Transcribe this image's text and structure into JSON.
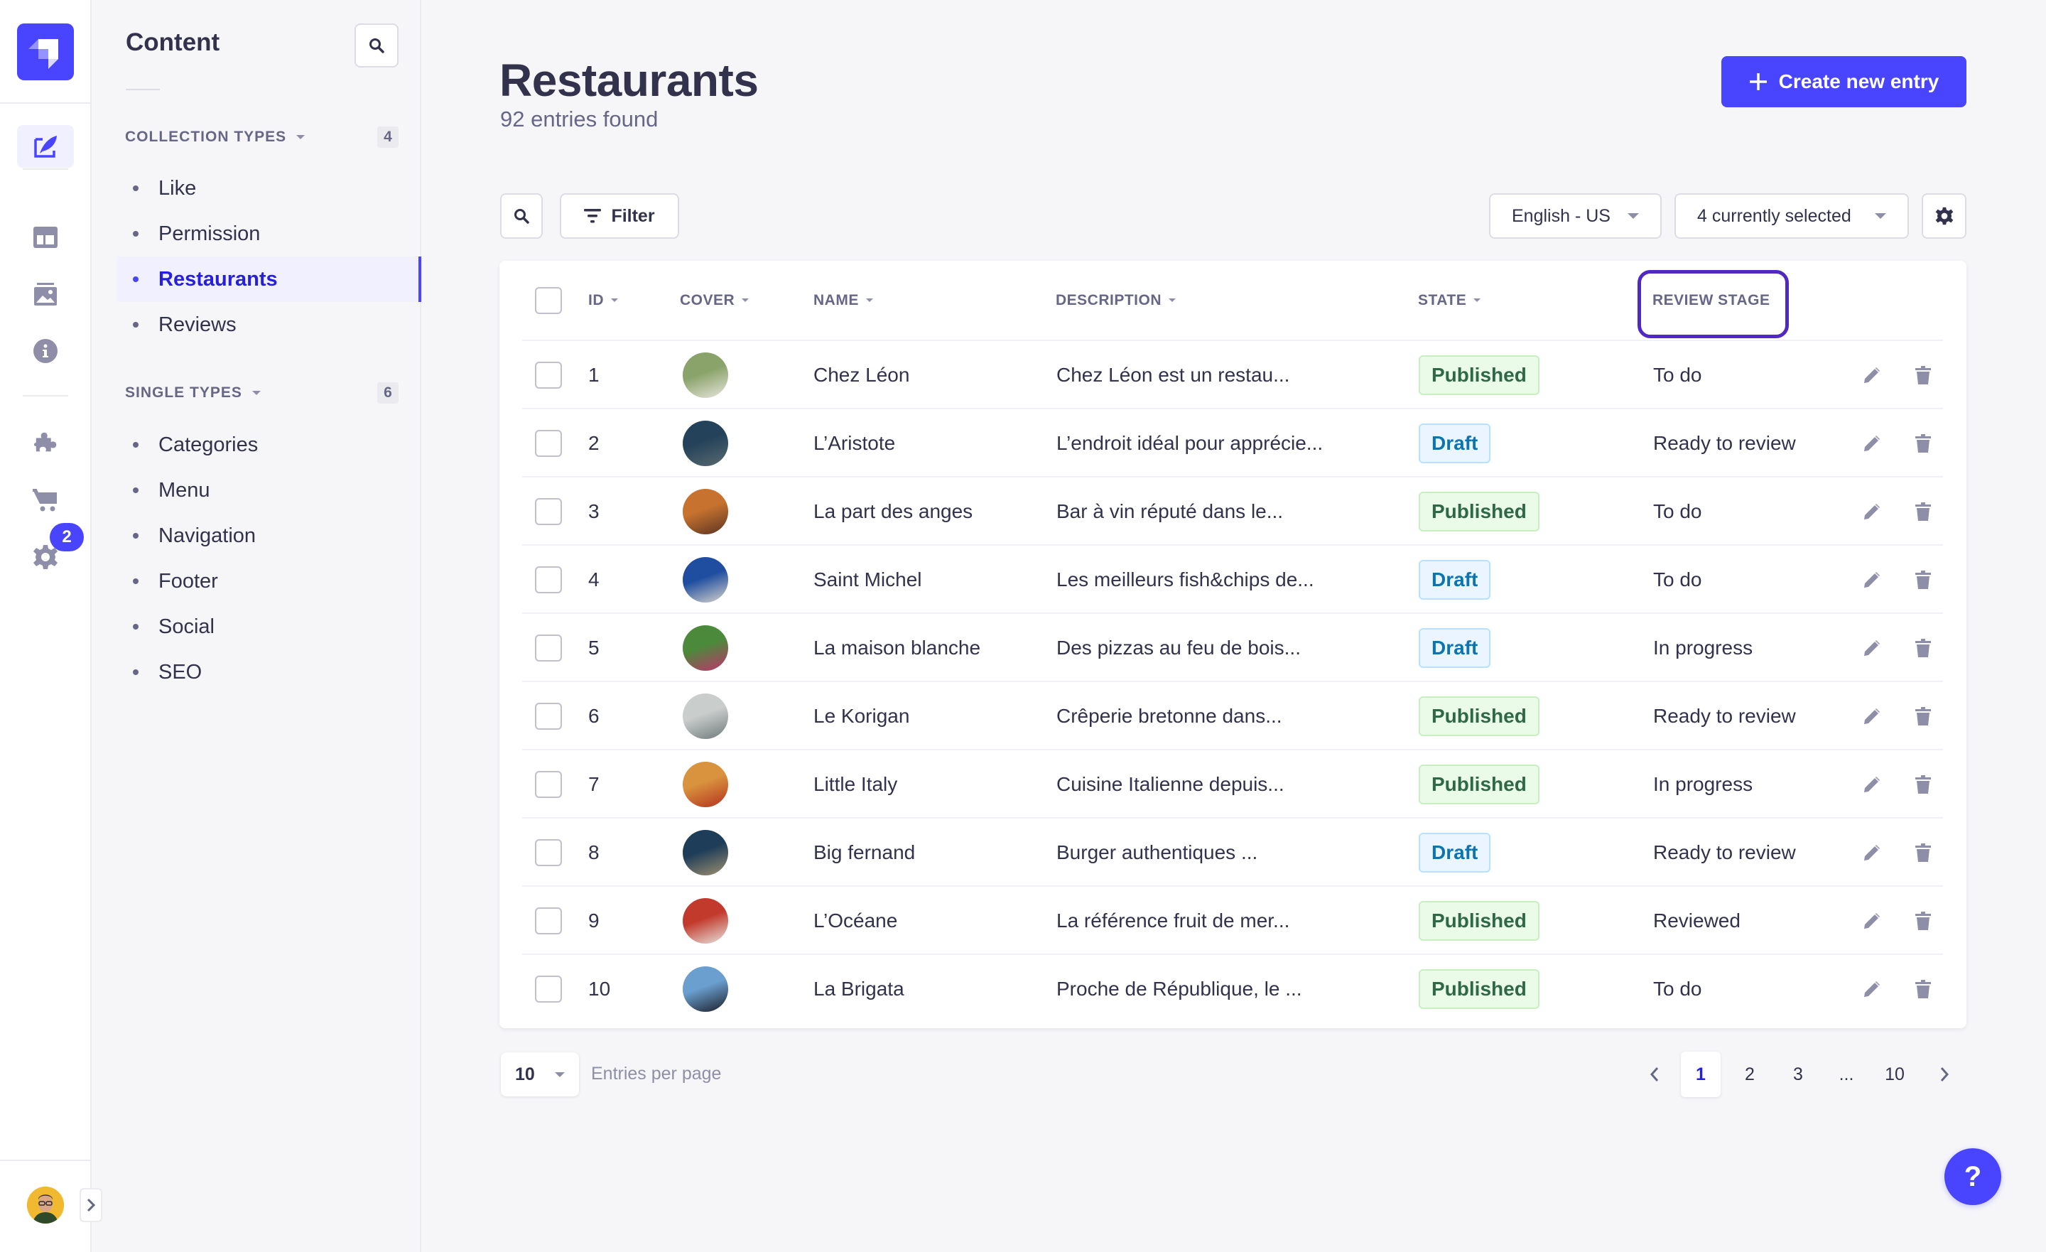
{
  "colors": {
    "primary": "#4945ff",
    "text": "#32324d",
    "muted": "#666687",
    "published_bg": "#eafbe7",
    "published_text": "#2f6846",
    "draft_bg": "#eaf5ff",
    "draft_text": "#0c75af",
    "highlight": "#5228c4"
  },
  "leftnav": {
    "items": [
      {
        "icon": "content-manager-feather-icon",
        "active": true
      },
      {
        "icon": "content-type-builder-layout-icon"
      },
      {
        "icon": "media-library-image-icon"
      },
      {
        "icon": "info-icon"
      },
      {
        "icon": "plugins-puzzle-icon"
      },
      {
        "icon": "marketplace-cart-icon"
      },
      {
        "icon": "settings-gear-icon",
        "badge": "2"
      }
    ],
    "user_avatar": "avatar"
  },
  "subnav": {
    "title": "Content",
    "collection_types": {
      "label": "COLLECTION TYPES",
      "count": "4",
      "items": [
        {
          "label": "Like"
        },
        {
          "label": "Permission"
        },
        {
          "label": "Restaurants",
          "active": true
        },
        {
          "label": "Reviews"
        }
      ]
    },
    "single_types": {
      "label": "SINGLE TYPES",
      "count": "6",
      "items": [
        {
          "label": "Categories"
        },
        {
          "label": "Menu"
        },
        {
          "label": "Navigation"
        },
        {
          "label": "Footer"
        },
        {
          "label": "Social"
        },
        {
          "label": "SEO"
        }
      ]
    }
  },
  "header": {
    "title": "Restaurants",
    "subtitle": "92 entries found",
    "create_label": "Create new entry"
  },
  "toolbar": {
    "filter_label": "Filter",
    "locale": "English - US",
    "columns": "4 currently selected"
  },
  "table": {
    "columns": {
      "id": "ID",
      "cover": "COVER",
      "name": "NAME",
      "description": "DESCRIPTION",
      "state": "STATE",
      "review_stage": "REVIEW STAGE"
    },
    "rows": [
      {
        "id": "1",
        "name": "Chez Léon",
        "description": "Chez Léon est un restau...",
        "state": "Published",
        "stage": "To do",
        "cover": [
          "#8aa36a",
          "#e8e6de"
        ]
      },
      {
        "id": "2",
        "name": "L’Aristote",
        "description": "L’endroit idéal pour apprécie...",
        "state": "Draft",
        "stage": "Ready to review",
        "cover": [
          "#24435a",
          "#5a6a70"
        ]
      },
      {
        "id": "3",
        "name": "La part des anges",
        "description": "Bar à vin réputé dans le...",
        "state": "Published",
        "stage": "To do",
        "cover": [
          "#c7722f",
          "#5a3420"
        ]
      },
      {
        "id": "4",
        "name": "Saint Michel",
        "description": "Les meilleurs fish&chips de...",
        "state": "Draft",
        "stage": "To do",
        "cover": [
          "#1f4ea0",
          "#d8d4cc"
        ]
      },
      {
        "id": "5",
        "name": "La maison blanche",
        "description": "Des pizzas au feu de bois...",
        "state": "Draft",
        "stage": "In progress",
        "cover": [
          "#4a8a3a",
          "#c2326c"
        ]
      },
      {
        "id": "6",
        "name": "Le Korigan",
        "description": "Crêperie bretonne dans...",
        "state": "Published",
        "stage": "Ready to review",
        "cover": [
          "#c9cdcc",
          "#6f7a7a"
        ]
      },
      {
        "id": "7",
        "name": "Little Italy",
        "description": "Cuisine Italienne depuis...",
        "state": "Published",
        "stage": "In progress",
        "cover": [
          "#d9923e",
          "#b2321e"
        ]
      },
      {
        "id": "8",
        "name": "Big fernand",
        "description": "Burger authentiques ...",
        "state": "Draft",
        "stage": "Ready to review",
        "cover": [
          "#1e3d58",
          "#a09070"
        ]
      },
      {
        "id": "9",
        "name": "L’Océane",
        "description": "La référence fruit de mer...",
        "state": "Published",
        "stage": "Reviewed",
        "cover": [
          "#c23a2c",
          "#e8e4de"
        ]
      },
      {
        "id": "10",
        "name": "La Brigata",
        "description": "Proche de République, le ...",
        "state": "Published",
        "stage": "To do",
        "cover": [
          "#6b9fd0",
          "#1a1e28"
        ]
      }
    ]
  },
  "pagination": {
    "per_page": "10",
    "per_page_label": "Entries per page",
    "pages": [
      "1",
      "2",
      "3",
      "...",
      "10"
    ],
    "current": "1"
  },
  "help_label": "?"
}
